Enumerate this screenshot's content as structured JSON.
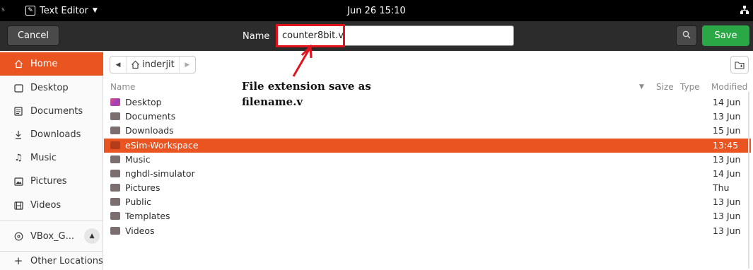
{
  "topbar": {
    "app_name": "Text Editor",
    "clock": "Jun 26  15:10"
  },
  "header": {
    "cancel_label": "Cancel",
    "name_label": "Name",
    "filename_value": "counter8bit.v",
    "save_label": "Save"
  },
  "sidebar": {
    "items": [
      {
        "label": "Home",
        "icon": "home-icon"
      },
      {
        "label": "Desktop",
        "icon": "desktop-icon"
      },
      {
        "label": "Documents",
        "icon": "documents-icon"
      },
      {
        "label": "Downloads",
        "icon": "downloads-icon"
      },
      {
        "label": "Music",
        "icon": "music-icon"
      },
      {
        "label": "Pictures",
        "icon": "pictures-icon"
      },
      {
        "label": "Videos",
        "icon": "videos-icon"
      }
    ],
    "device": {
      "label": "VBox_G...",
      "icon": "disc-icon"
    },
    "other_locations": "Other Locations"
  },
  "pathbar": {
    "crumb": "inderjit"
  },
  "columns": {
    "name": "Name",
    "size": "Size",
    "type": "Type",
    "modified": "Modified"
  },
  "files": [
    {
      "name": "Desktop",
      "modified": "14 Jun"
    },
    {
      "name": "Documents",
      "modified": "13 Jun"
    },
    {
      "name": "Downloads",
      "modified": "15 Jun"
    },
    {
      "name": "eSim-Workspace",
      "modified": "13:45",
      "selected": true
    },
    {
      "name": "Music",
      "modified": "13 Jun"
    },
    {
      "name": "nghdl-simulator",
      "modified": "14 Jun"
    },
    {
      "name": "Pictures",
      "modified": "Thu"
    },
    {
      "name": "Public",
      "modified": "13 Jun"
    },
    {
      "name": "Templates",
      "modified": "13 Jun"
    },
    {
      "name": "Videos",
      "modified": "13 Jun"
    }
  ],
  "annotation": {
    "line1": "File extension save as",
    "line2": "filename.v"
  },
  "colors": {
    "accent": "#e95420",
    "save_green": "#29a845",
    "annotation_red": "#e0141e"
  }
}
